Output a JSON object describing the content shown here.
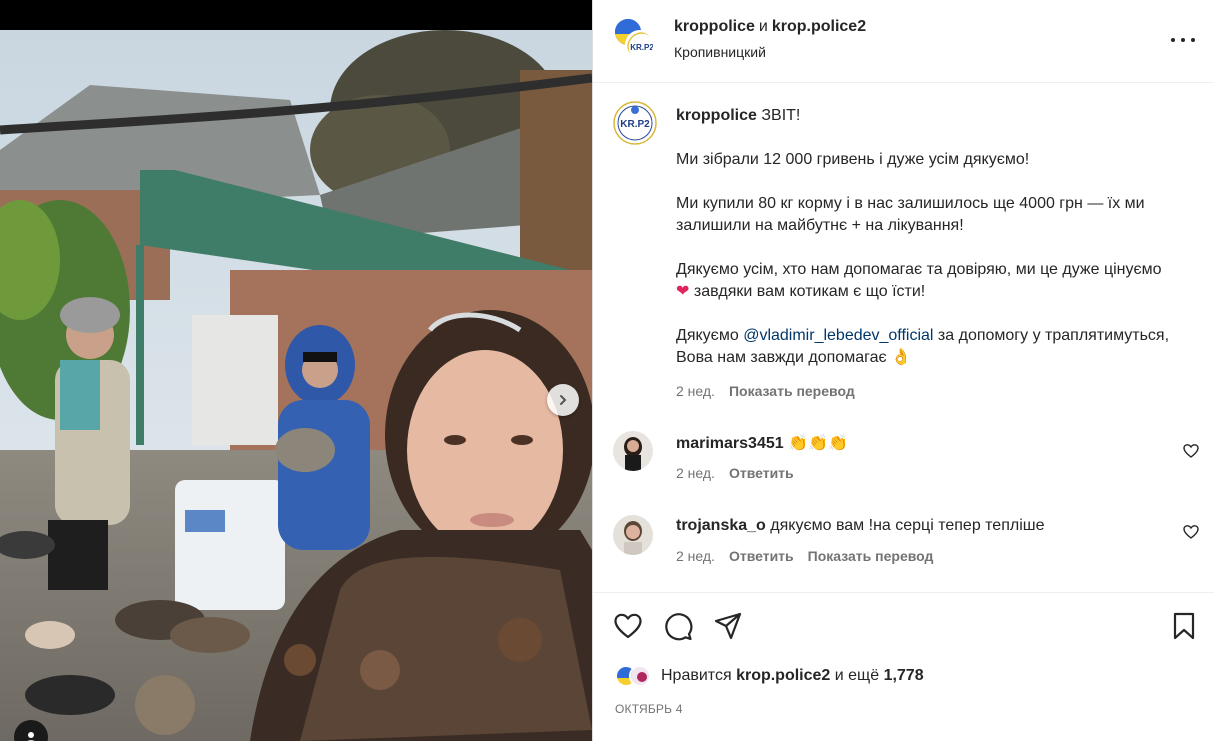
{
  "post": {
    "author_primary": "kroppolice",
    "conjunction": "и",
    "author_collab": "krop.police2",
    "location": "Кропивницкий",
    "avatar_text": "KR.P2"
  },
  "caption": {
    "username": "kroppolice",
    "line1": "ЗВІТ!",
    "para1": "Ми зібрали 12 000 гривень і дуже усім дякуємо!",
    "para2": "Ми купили 80 кг корму і в нас залишилось ще 4000 грн — їх ми залишили на майбутнє + на лікування!",
    "para3_a": "Дякуємо усім, хто нам допомагає та довіряю, ми це дуже цінуємо",
    "para3_heart": "❤",
    "para3_b": "завдяки вам котикам є що їсти!",
    "para4_a": "Дякуємо",
    "para4_mention": "@vladimir_lebedev_official",
    "para4_b": "за допомогу у траплятимуться, Вова нам завжди допомагає",
    "para4_emoji": "👌",
    "time": "2 нед.",
    "translate": "Показать перевод"
  },
  "comments": [
    {
      "username": "marimars3451",
      "text": "👏👏👏",
      "time": "2 нед.",
      "reply": "Ответить",
      "translate": ""
    },
    {
      "username": "trojanska_o",
      "text": "дякуємо вам !на серці тепер тепліше",
      "time": "2 нед.",
      "reply": "Ответить",
      "translate": "Показать перевод"
    }
  ],
  "likes": {
    "prefix": "Нравится",
    "user": "krop.police2",
    "and_more": "и ещё",
    "count": "1,778"
  },
  "date": "ОКТЯБРЬ 4",
  "icons": {
    "like": "heart-icon",
    "comment": "comment-icon",
    "share": "share-icon",
    "save": "bookmark-icon",
    "options": "more-options-icon",
    "next": "chevron-right-icon",
    "tag": "user-tag-icon"
  },
  "colors": {
    "text": "#262626",
    "secondary": "#737373",
    "mention": "#00376b",
    "heart": "#e0245e",
    "border": "#dbdbdb"
  }
}
